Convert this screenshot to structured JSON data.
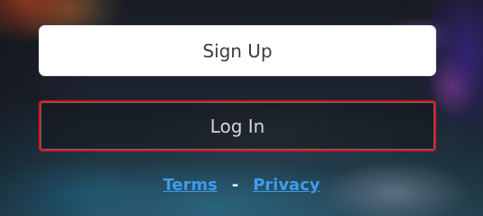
{
  "actions": {
    "signup_label": "Sign Up",
    "login_label": "Log In"
  },
  "footer": {
    "terms_label": "Terms",
    "separator": "-",
    "privacy_label": "Privacy"
  },
  "colors": {
    "login_border": "#e3111b",
    "link": "#3f9bea",
    "signup_bg": "#ffffff"
  }
}
